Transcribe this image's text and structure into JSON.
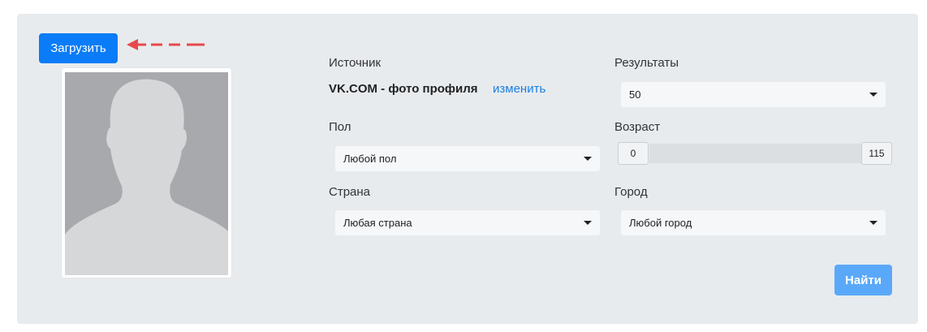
{
  "upload": {
    "label": "Загрузить"
  },
  "source": {
    "label": "Источник",
    "value": "VK.COM - фото профиля",
    "change_link": "изменить"
  },
  "results": {
    "label": "Результаты",
    "value": "50"
  },
  "gender": {
    "label": "Пол",
    "value": "Любой пол"
  },
  "age": {
    "label": "Возраст",
    "min": "0",
    "max": "115"
  },
  "country": {
    "label": "Страна",
    "value": "Любая страна"
  },
  "city": {
    "label": "Город",
    "value": "Любой город"
  },
  "search": {
    "label": "Найти"
  },
  "icons": {
    "arrow": "arrow-left-dashed-icon",
    "placeholder": "person-silhouette-icon",
    "caret": "caret-down-icon"
  },
  "colors": {
    "primary": "#0a7cf7",
    "primary_light": "#5aa8f9",
    "arrow": "#e8484c",
    "panel": "#e8ebee",
    "link": "#1a7fe0"
  }
}
